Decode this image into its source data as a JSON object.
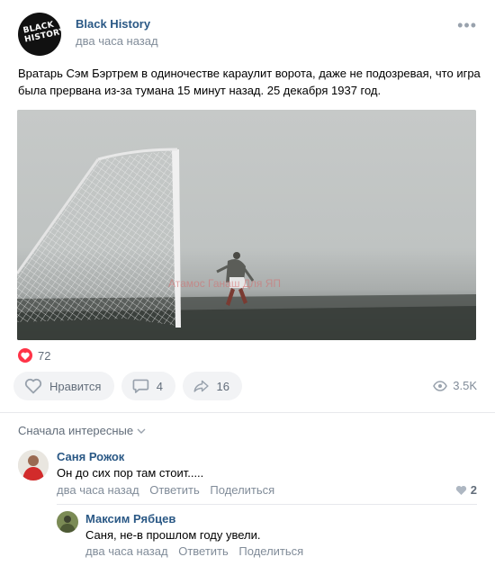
{
  "post": {
    "author": "Black History",
    "time": "два часа назад",
    "logo_text": "BLACK HISTORY",
    "text": "Вратарь Сэм Бэртрем в одиночестве караулит ворота, даже не подозревая, что игра была прервана из-за тумана 15 минут назад. 25 декабря 1937 год.",
    "image_watermark": "Атамос Ганаш Для ЯП",
    "likes_count": "72",
    "actions": {
      "like_label": "Нравится",
      "comments_count": "4",
      "shares_count": "16"
    },
    "views": "3.5K"
  },
  "comments_section": {
    "sort_label": "Сначала интересные"
  },
  "comments": [
    {
      "name": "Саня Рожок",
      "text": "Он до сих пор там стоит.....",
      "time": "два часа назад",
      "reply_label": "Ответить",
      "share_label": "Поделиться",
      "likes": "2"
    },
    {
      "name": "Максим Рябцев",
      "text": "Саня, не-в прошлом году увели.",
      "time": "два часа назад",
      "reply_label": "Ответить",
      "share_label": "Поделиться"
    }
  ],
  "colors": {
    "link": "#2a5885",
    "muted": "#818c99",
    "like_red": "#ff3347",
    "button_bg": "#f2f3f5"
  },
  "icons": [
    "more-icon",
    "heart-icon",
    "comment-icon",
    "share-icon",
    "eye-icon",
    "chevron-down-icon"
  ]
}
